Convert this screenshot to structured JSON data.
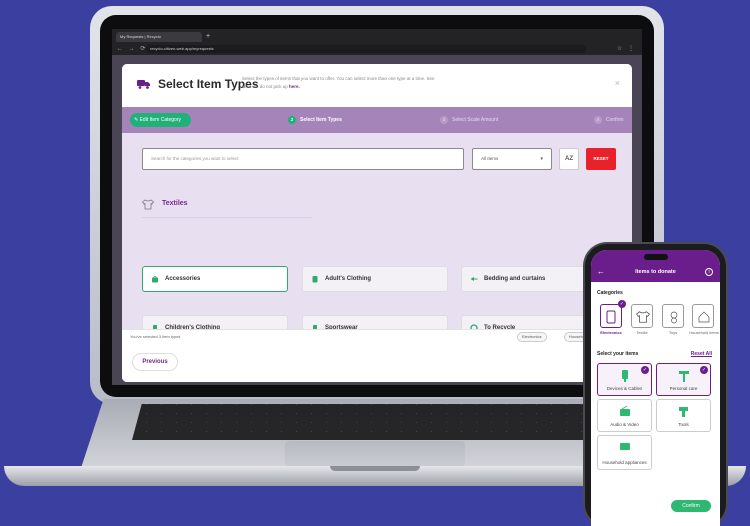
{
  "browser": {
    "tab_title": "My Requests | Recyclo",
    "url": "recyclo-citizen-web.app/myrequests"
  },
  "modal": {
    "title": "Select Item Types",
    "description": "Select the types of items that you want to offer. You can select more than one type at a time. See what we do not pick up",
    "description_link": "here.",
    "close_label": "×"
  },
  "steps": [
    {
      "num": "",
      "label": "Edit Item Category"
    },
    {
      "num": "2",
      "label": "Select Item Types"
    },
    {
      "num": "3",
      "label": "Select Scale Amount"
    },
    {
      "num": "4",
      "label": "Confirm"
    }
  ],
  "filters": {
    "search_placeholder": "Search for the categories you want to select",
    "select_value": "All Items",
    "sort_label": "AZ",
    "reset_label": "RESET"
  },
  "section": {
    "title": "Textiles"
  },
  "cards": [
    {
      "label": "Accessories",
      "selected": true
    },
    {
      "label": "Adult's Clothing",
      "selected": false
    },
    {
      "label": "Bedding and curtains",
      "selected": false
    },
    {
      "label": "Children's Clothing",
      "selected": false
    },
    {
      "label": "Sportswear",
      "selected": false
    },
    {
      "label": "To Recycle",
      "selected": false
    }
  ],
  "footer": {
    "note": "You've selected 3 item types",
    "chips": [
      "Electronics",
      "Household It"
    ],
    "previous_label": "Previous"
  },
  "phone": {
    "header_title": "Items to donate",
    "categories_label": "Categories",
    "categories": [
      "Electronics",
      "Textile",
      "Toys",
      "Household items"
    ],
    "select_items_label": "Select your items",
    "reset_all_label": "Reset All",
    "items": [
      "Devices & Cables",
      "Personal care",
      "Audio & Video",
      "Tools",
      "Household appliances"
    ],
    "confirm_label": "Confirm"
  },
  "colors": {
    "brand_purple": "#6a1e8c",
    "stepper_bg": "#a584ba",
    "green": "#22b07a",
    "reset_red": "#e8212a",
    "background": "#3a3fa0"
  }
}
